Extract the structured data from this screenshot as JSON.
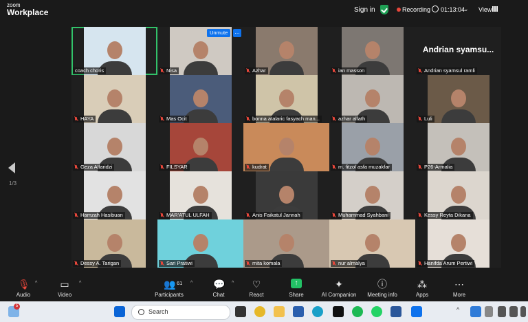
{
  "app": {
    "logo_small": "zoom",
    "logo_big": "Workplace"
  },
  "header": {
    "sign_in": "Sign in",
    "recording": "Recording",
    "time": "01:13:04",
    "view": "View"
  },
  "nav": {
    "page_indicator": "1/3"
  },
  "tiles": [
    {
      "name": "coach choris",
      "bg": "#d6e5ef",
      "active": true,
      "muted": false
    },
    {
      "name": "Nisa",
      "bg": "#cfc9c2",
      "muted": true
    },
    {
      "name": "Azhar",
      "bg": "#8a7a6d",
      "muted": true
    },
    {
      "name": "ian masson",
      "bg": "#7d7772",
      "muted": true
    },
    {
      "name": "Andrian syamsul ramli",
      "bg": "#1f1f1f",
      "muted": true,
      "big": "Andrian  syamsu..."
    },
    {
      "name": "HAYA",
      "bg": "#d9cdb8",
      "muted": true
    },
    {
      "name": "Mas Ocit",
      "bg": "#4b5c7a",
      "muted": true
    },
    {
      "name": "bonna atalaric fasyach man...",
      "bg": "#cfc4a8",
      "muted": true
    },
    {
      "name": "azhar alfath",
      "bg": "#bdb8b2",
      "muted": true
    },
    {
      "name": "Luli",
      "bg": "#6b5a48",
      "muted": true
    },
    {
      "name": "Geza Alfaridzi",
      "bg": "#d8d8d8",
      "muted": true
    },
    {
      "name": "FILSYAR",
      "bg": "#a6463a",
      "muted": true
    },
    {
      "name": "kudrat",
      "bg": "#c98a5a",
      "muted": true
    },
    {
      "name": "m. fitzol asfa muzakfar",
      "bg": "#9aa0a8",
      "muted": true
    },
    {
      "name": "P26-Armalia",
      "bg": "#c4c0ba",
      "muted": true
    },
    {
      "name": "Hamzah Hasibuan",
      "bg": "#e2e2e2",
      "muted": true
    },
    {
      "name": "MAR'ATUL ULFAH",
      "bg": "#e6e2dc",
      "muted": true
    },
    {
      "name": "Anis Faikatul Jannah",
      "bg": "#3a3a3a",
      "muted": true
    },
    {
      "name": "Muhammad Syahbani",
      "bg": "#d4cfc9",
      "muted": true
    },
    {
      "name": "Kessy Reyta Dikana",
      "bg": "#dcd6ce",
      "muted": true
    },
    {
      "name": "Dessy A. Tarigan",
      "bg": "#c9b99c",
      "muted": true
    },
    {
      "name": "Sari Pratiwi",
      "bg": "#6fd1dc",
      "muted": true
    },
    {
      "name": "mita komala",
      "bg": "#ab9a8a",
      "muted": true
    },
    {
      "name": "nur almalya",
      "bg": "#d8c8b2",
      "muted": true
    },
    {
      "name": "Hanifda Arum Pertiwi",
      "bg": "#e6dfd8",
      "muted": true
    }
  ],
  "nisa_controls": {
    "unmute": "Unmute",
    "more": "…"
  },
  "toolbar": {
    "audio": "Audio",
    "video": "Video",
    "participants": "Participants",
    "participants_count": "61",
    "chat": "Chat",
    "react": "React",
    "share": "Share",
    "ai_companion": "AI Companion",
    "meeting_info": "Meeting info",
    "apps": "Apps",
    "more": "More"
  },
  "taskbar": {
    "search_placeholder": "Search",
    "notification_badge": "5"
  },
  "colors": {
    "accent": "#0e72ed",
    "recording": "#e8473b",
    "secure": "#1fa155",
    "share": "#23c266",
    "muted": "#e8473b",
    "active_border": "#32c26a"
  }
}
